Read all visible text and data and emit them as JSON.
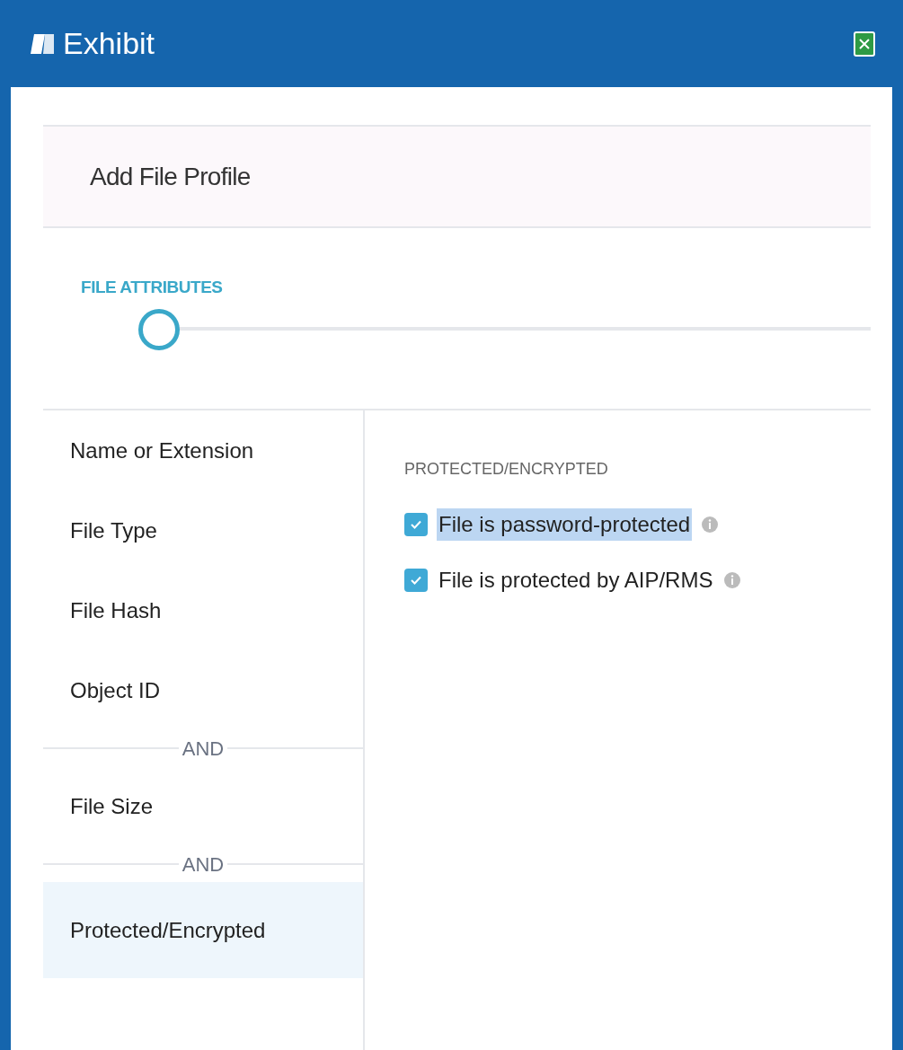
{
  "window": {
    "title": "Exhibit"
  },
  "header": {
    "title": "Add File Profile"
  },
  "stepper": {
    "label": "FILE ATTRIBUTES"
  },
  "sidebar": {
    "items": [
      {
        "kind": "item",
        "label": "Name or Extension",
        "selected": false
      },
      {
        "kind": "item",
        "label": "File Type",
        "selected": false
      },
      {
        "kind": "item",
        "label": "File Hash",
        "selected": false
      },
      {
        "kind": "item",
        "label": "Object ID",
        "selected": false
      },
      {
        "kind": "separator",
        "label": "AND"
      },
      {
        "kind": "item",
        "label": "File Size",
        "selected": false
      },
      {
        "kind": "separator",
        "label": "AND"
      },
      {
        "kind": "item",
        "label": "Protected/Encrypted",
        "selected": true
      }
    ]
  },
  "panel": {
    "heading": "PROTECTED/ENCRYPTED",
    "options": [
      {
        "label": "File is password-protected",
        "checked": true,
        "highlighted": true
      },
      {
        "label": "File is protected by AIP/RMS",
        "checked": true,
        "highlighted": false
      }
    ]
  }
}
